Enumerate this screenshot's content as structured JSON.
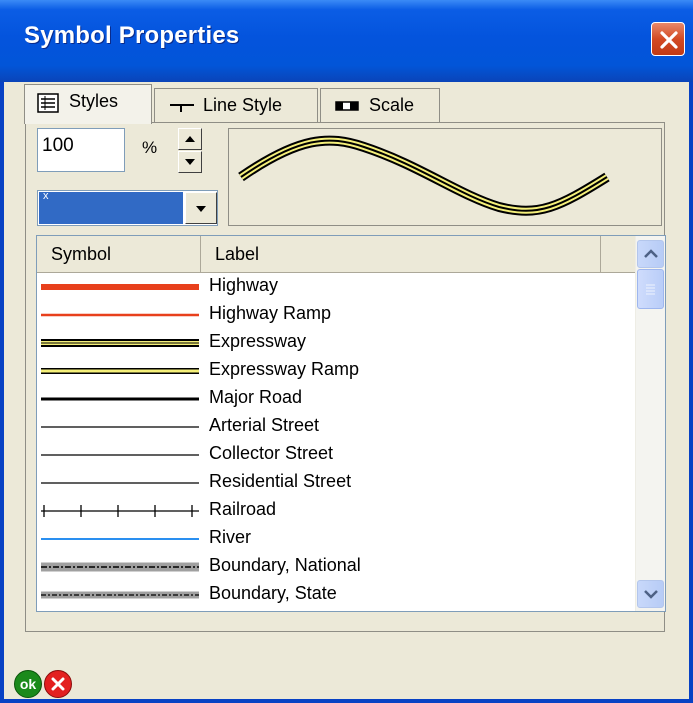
{
  "window": {
    "title": "Symbol Properties"
  },
  "tabs": [
    {
      "label": "Styles",
      "icon": "list-icon",
      "active": true
    },
    {
      "label": "Line Style",
      "icon": "line-style-icon",
      "active": false
    },
    {
      "label": "Scale",
      "icon": "scale-icon",
      "active": false
    }
  ],
  "scale": {
    "value": "100",
    "unit": "%"
  },
  "style_combo": {
    "selected": "x"
  },
  "list": {
    "columns": [
      "Symbol",
      "Label"
    ],
    "rows": [
      {
        "label": "Highway",
        "style": "highway"
      },
      {
        "label": "Highway Ramp",
        "style": "highway-ramp"
      },
      {
        "label": "Expressway",
        "style": "expressway"
      },
      {
        "label": "Expressway Ramp",
        "style": "expressway-ramp"
      },
      {
        "label": "Major Road",
        "style": "major-road"
      },
      {
        "label": "Arterial Street",
        "style": "thin"
      },
      {
        "label": "Collector Street",
        "style": "thin"
      },
      {
        "label": "Residential Street",
        "style": "thin"
      },
      {
        "label": "Railroad",
        "style": "railroad"
      },
      {
        "label": "River",
        "style": "river"
      },
      {
        "label": "Boundary, National",
        "style": "boundary-national"
      },
      {
        "label": "Boundary, State",
        "style": "boundary-state"
      }
    ]
  },
  "footer": {
    "ok_label": "ok"
  },
  "colors": {
    "highway": "#e8401c",
    "expressway_fill": "#f5f07a",
    "river": "#2a8ff0",
    "titlebar": "#0454dd"
  }
}
